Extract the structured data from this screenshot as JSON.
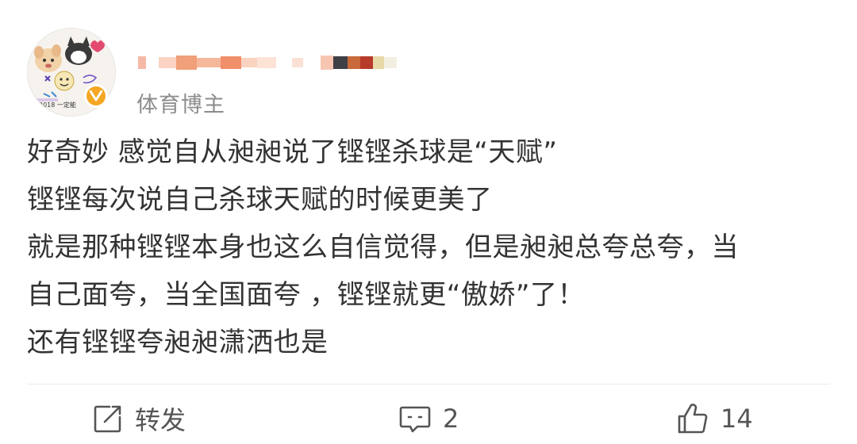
{
  "colors": {
    "text_primary": "#333333",
    "text_secondary": "#8c8c8c",
    "icon": "#555555",
    "verified_badge": "#f5a623"
  },
  "header": {
    "avatar_caption": "2018 一定能",
    "username": "",
    "user_tag": "体育博主",
    "verified_icon": "verified-v-icon"
  },
  "post": {
    "lines": [
      "好奇妙 感觉自从昶昶说了铿铿杀球是“天赋”",
      "铿铿每次说自己杀球天赋的时候更美了",
      "就是那种铿铿本身也这么自信觉得，但是昶昶总夸总夸，当",
      "自己面夸，当全国面夸 ，铿铿就更“傲娇”了！",
      "还有铿铿夸昶昶潇洒也是"
    ]
  },
  "footer": {
    "repost": {
      "icon": "repost-icon",
      "label": "转发"
    },
    "comment": {
      "icon": "comment-icon",
      "count": "2"
    },
    "like": {
      "icon": "thumbs-up-icon",
      "count": "14"
    }
  }
}
